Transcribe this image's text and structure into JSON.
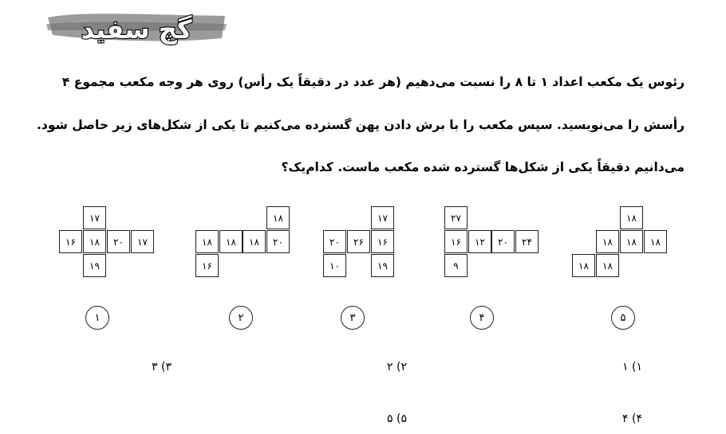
{
  "logo": {
    "text": "گچ سفید",
    "brush_color": "#8a8a8a"
  },
  "question": {
    "lines": [
      "رئوس یک مکعب اعداد ۱ تا ۸ را نسبت می‌دهیم (هر عدد در دقیقاً یک رأس) روی هر وجه مکعب مجموع ۴",
      "رأسش را می‌نویسید. سپس مکعب را با برش دادن پهن گسترده می‌کنیم تا یکی از شکل‌های زیر حاصل شود.",
      "می‌دانیم دقیقاً یکی از شکل‌ها گسترده شده مکعب ماست. کدام‌یک؟"
    ]
  },
  "nets": [
    {
      "label": "۱",
      "cells": [
        "۱۷",
        "۱۶",
        "۱۸",
        "۲۰",
        "۱۷",
        "۱۹"
      ]
    },
    {
      "label": "۲",
      "cells": [
        "۱۸",
        "۱۸",
        "۱۸",
        "۱۸",
        "۲۰",
        "۱۶"
      ]
    },
    {
      "label": "۳",
      "cells": [
        "۱۷",
        "۲۰",
        "۲۶",
        "۱۶",
        "۱۰",
        "۱۹"
      ]
    },
    {
      "label": "۴",
      "cells": [
        "۲۷",
        "۱۶",
        "۱۲",
        "۲۰",
        "۲۴",
        "۹"
      ]
    },
    {
      "label": "۵",
      "cells": [
        "۱۸",
        "۱۸",
        "۱۸",
        "۱۸",
        "۱۸",
        "۱۸"
      ]
    }
  ],
  "options": [
    "۱) ۱",
    "۲) ۲",
    "۳) ۳",
    "۴) ۴",
    "۵) ۵"
  ]
}
